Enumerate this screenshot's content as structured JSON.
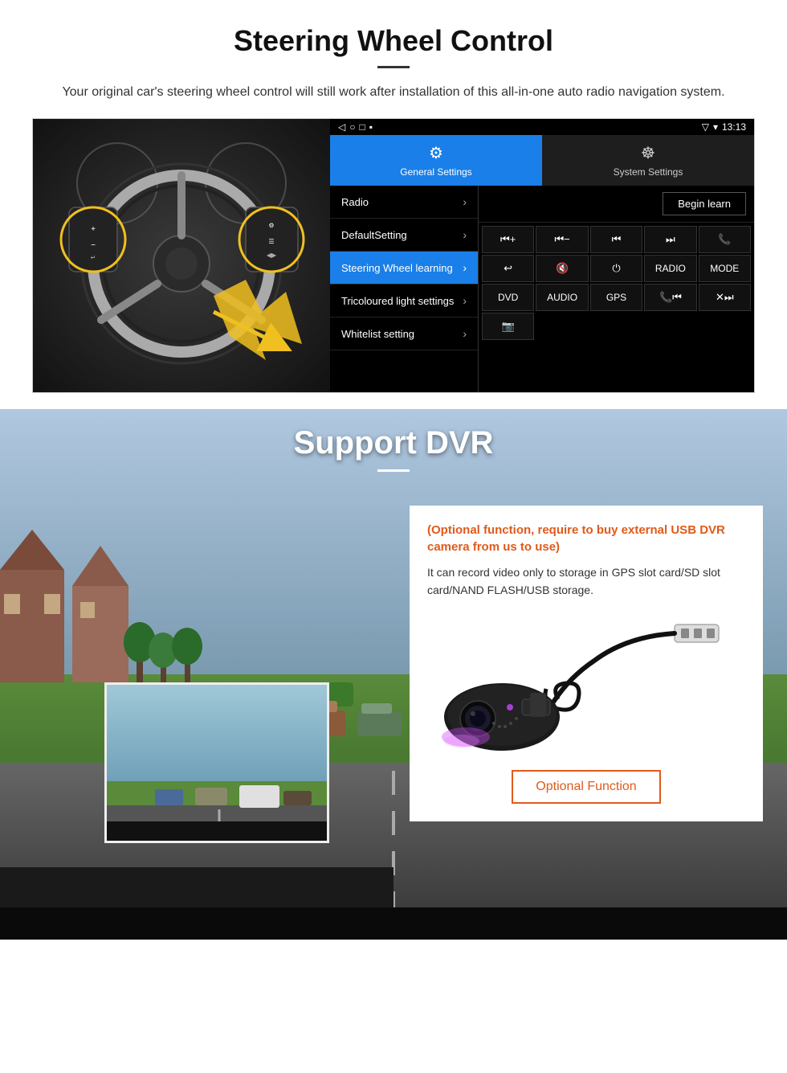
{
  "steering": {
    "title": "Steering Wheel Control",
    "description": "Your original car's steering wheel control will still work after installation of this all-in-one auto radio navigation system.",
    "status_bar": {
      "signal": "▼",
      "wifi": "▾",
      "time": "13:13"
    },
    "tabs": [
      {
        "id": "general",
        "icon": "⚙",
        "label": "General Settings",
        "active": true
      },
      {
        "id": "system",
        "icon": "🌐",
        "label": "System Settings",
        "active": false
      }
    ],
    "menu_items": [
      {
        "id": "radio",
        "label": "Radio",
        "selected": false
      },
      {
        "id": "default",
        "label": "DefaultSetting",
        "selected": false
      },
      {
        "id": "steering",
        "label": "Steering Wheel learning",
        "selected": true
      },
      {
        "id": "tricolour",
        "label": "Tricoloured light settings",
        "selected": false
      },
      {
        "id": "whitelist",
        "label": "Whitelist setting",
        "selected": false
      }
    ],
    "begin_learn": "Begin learn",
    "buttons": [
      "⏮+",
      "⏮-",
      "⏮⏮",
      "⏭⏭",
      "📞",
      "↩",
      "🔇",
      "⏻",
      "RADIO",
      "MODE",
      "DVD",
      "AUDIO",
      "GPS",
      "📞⏮",
      "✕⏭",
      "📷"
    ]
  },
  "dvr": {
    "title": "Support DVR",
    "optional_text": "(Optional function, require to buy external USB DVR camera from us to use)",
    "description": "It can record video only to storage in GPS slot card/SD slot card/NAND FLASH/USB storage.",
    "optional_button": "Optional Function"
  }
}
